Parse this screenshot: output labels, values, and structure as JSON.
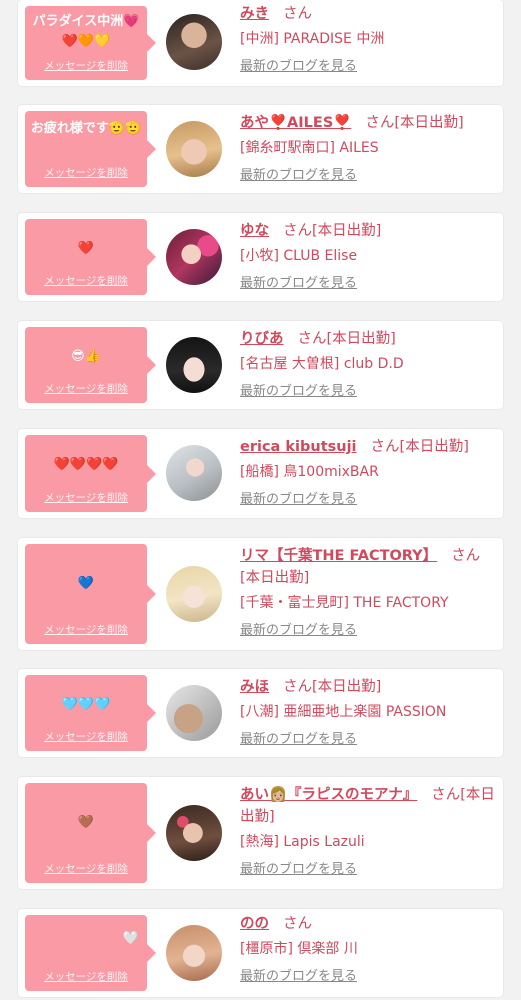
{
  "delete_label": "メッセージを削除",
  "blog_label": "最新のブログを見る",
  "honorific": "さん",
  "colors": {
    "bubble": "#f99aa5",
    "name": "#d1495d",
    "blog": "#888888"
  },
  "items": [
    {
      "message": "パラダイス中洲💗❤️🧡💛",
      "name": "みき",
      "status": "",
      "shop": "[中洲] PARADISE 中洲"
    },
    {
      "message": "お疲れ様です🫡🫡",
      "name": "あや❣️AILES❣️",
      "status": "[本日出勤]",
      "shop": "[錦糸町駅南口] AILES"
    },
    {
      "message": "❤️",
      "name": "ゆな",
      "status": "[本日出勤]",
      "shop": "[小牧] CLUB Elise"
    },
    {
      "message": "😎👍",
      "name": "りびあ",
      "status": "[本日出勤]",
      "shop": "[名古屋 大曽根] club D.D"
    },
    {
      "message": "❤️❤️❤️❤️",
      "name": "erica kibutsuji",
      "status": "[本日出勤]",
      "shop": "[船橋] 鳥100mixBAR"
    },
    {
      "message": "💙",
      "name": "リマ【千葉THE FACTORY】",
      "status": "[本日出勤]",
      "shop": "[千葉・富士見町] THE FACTORY"
    },
    {
      "message": "🩵🩵🩵",
      "name": "みほ",
      "status": "[本日出勤]",
      "shop": "[八潮] 亜細亜地上楽園 PASSION"
    },
    {
      "message": "🤎",
      "name": "あい👩🏼『ラピスのモアナ』",
      "status": "[本日出勤]",
      "shop": "[熱海] Lapis Lazuli"
    },
    {
      "message": "🤍",
      "name": "のの",
      "status": "",
      "shop": "[橿原市] 倶楽部 川"
    }
  ]
}
